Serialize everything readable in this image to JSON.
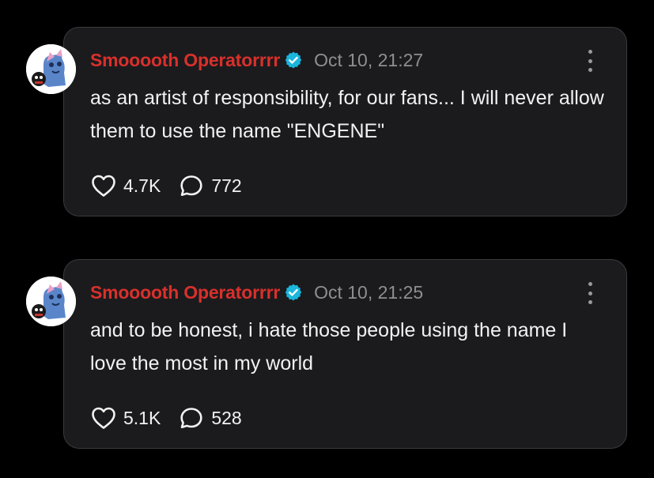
{
  "posts": [
    {
      "author": "Smooooth Operatorrrr",
      "timestamp": "Oct 10, 21:27",
      "text": "as an artist of responsibility, for our fans... I will never allow them to use the name \"ENGENE\"",
      "likes": "4.7K",
      "comments": "772"
    },
    {
      "author": "Smooooth Operatorrrr",
      "timestamp": "Oct 10, 21:25",
      "text": "and to be honest, i hate those people using the name I love the most in my world",
      "likes": "5.1K",
      "comments": "528"
    }
  ],
  "icons": {
    "verified": "verified-badge-icon",
    "like": "heart-icon",
    "comment": "speech-bubble-icon",
    "more": "vertical-ellipsis-icon"
  },
  "colors": {
    "background": "#000000",
    "card": "#1b1b1d",
    "card_border": "#3a3a3e",
    "author": "#d9302c",
    "verified": "#1ab6dc",
    "timestamp": "#8e8e93",
    "text": "#f2f2f2"
  }
}
